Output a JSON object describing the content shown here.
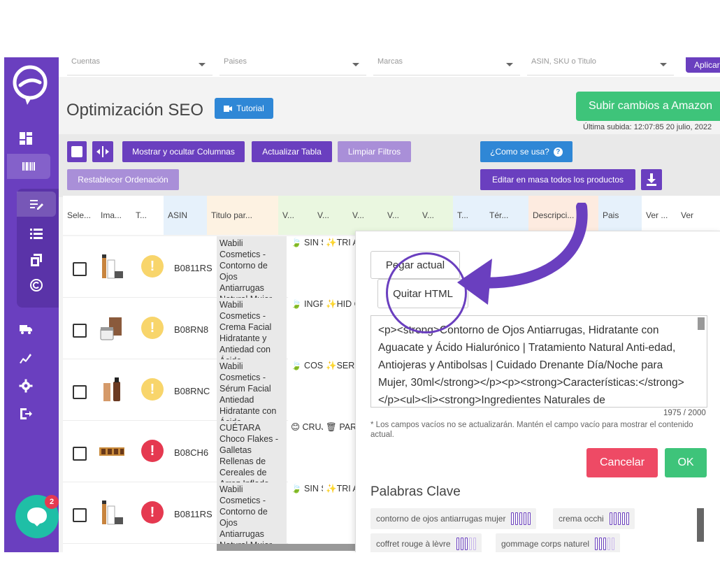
{
  "filters": {
    "cuentas": "Cuentas",
    "paises": "Paises",
    "marcas": "Marcas",
    "search": "ASIN, SKU o Titulo",
    "apply_label": "Aplicar"
  },
  "header": {
    "title": "Optimización SEO",
    "tutorial_label": "Tutorial",
    "upload_label": "Subir cambios a Amazon",
    "last_upload": "Última subida: 12:07:85 20 julio, 2022"
  },
  "toolbar": {
    "show_hide_columns": "Mostrar y ocultar Columnas",
    "update_table": "Actualizar Tabla",
    "clear_filters": "Limpiar Filtros",
    "how_to_use": "¿Como se usa?",
    "reset_order": "Restablecer Ordenación",
    "bulk_edit": "Editar en masa todos los productos"
  },
  "table": {
    "headers": [
      "Sele...",
      "Ima...",
      "T...",
      "ASIN",
      "Titulo par...",
      "V...",
      "V...",
      "V...",
      "V...",
      "V...",
      "T...",
      "Tér...",
      "Descripci...",
      "Pais",
      "Ver ...",
      "Ver"
    ],
    "rows": [
      {
        "asin": "B0811RS",
        "status": "warn",
        "title": "Wabili Cosmetics - Contorno de Ojos Antiarrugas Natural Mujer",
        "v1": "🍃 SIN SULFA NI PARAB",
        "v2": "✨TRI ACCIÓ - Hidrata Reafirm"
      },
      {
        "asin": "B08RN8",
        "status": "warn",
        "title": "Wabili Cosmetics - Crema Facial Hidratante y Antiedad con Ácido",
        "v1": "🍃 INGRE NATUR - SIN SULFA",
        "v2": "✨HID CON ÁCIDO HIALUR"
      },
      {
        "asin": "B08RNC",
        "status": "warn",
        "title": "Wabili Cosmetics - Sérum Facial Antiedad Hidratante con Ácido",
        "v1": "🍃 COSMI NATUR - SIN SULFA",
        "v2": "✨SER PARA TODO TIPO DE"
      },
      {
        "asin": "B08CH6",
        "status": "err",
        "title": "CUÉTARA Choco Flakes - Galletas Rellenas de Cereales de Arroz Inflado",
        "v1": "😊 CRUJI GALLE RELLE DE",
        "v2": "🗑 PARA DEBOR EN UN"
      },
      {
        "asin": "B0811RS",
        "status": "err",
        "title": "Wabili Cosmetics - Contorno de Ojos Antiarrugas Natural Mujer",
        "v1": "🍃 SIN SULFA NI PARAB",
        "v2": "✨TRI ACCIÓ - Hidrata Reafirm"
      }
    ]
  },
  "modal": {
    "paste_current": "Pegar actual",
    "remove_html": "Quitar HTML",
    "text": "<p><strong>Contorno de Ojos Antiarrugas, Hidratante con Aguacate y Ácido Hialurónico | Tratamiento Natural Anti-edad, Antiojeras y Antibolsas | Cuidado Drenante Día/Noche para Mujer, 30ml</strong></p><p><strong>Características:</strong></p><ul><li><strong>Ingredientes Naturales de",
    "counter": "1975 / 2000",
    "note": "* Los campos vacíos no se actualizarán. Mantén el campo vacío para mostrar el contenido actual.",
    "cancel": "Cancelar",
    "ok": "OK",
    "keywords_title": "Palabras Clave",
    "keywords": [
      {
        "label": "contorno de ojos antiarrugas mujer",
        "level": 5
      },
      {
        "label": "crema occhi",
        "level": 5
      },
      {
        "label": "coffret rouge à lèvre",
        "level": 3
      },
      {
        "label": "gommage corps naturel",
        "level": 3
      }
    ]
  },
  "chat": {
    "badge": "2"
  },
  "colors": {
    "brand": "#6a3fbf",
    "green": "#3ec47a",
    "blue": "#2f87d6",
    "red": "#e53950",
    "yellow": "#f8d56b"
  }
}
